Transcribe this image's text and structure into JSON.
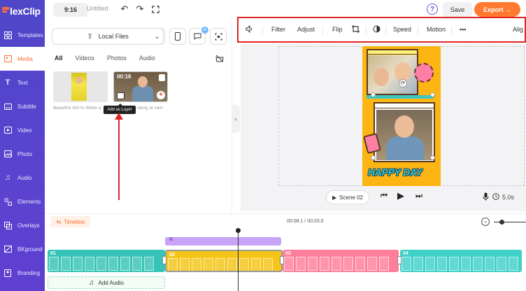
{
  "app": {
    "logo_text": "lexClip"
  },
  "sidebar": {
    "items": [
      {
        "label": "Templates",
        "icon": "templates-icon"
      },
      {
        "label": "Media",
        "icon": "media-icon",
        "active": true
      },
      {
        "label": "Text",
        "icon": "text-icon"
      },
      {
        "label": "Subtitle",
        "icon": "subtitle-icon"
      },
      {
        "label": "Video",
        "icon": "video-icon"
      },
      {
        "label": "Photo",
        "icon": "photo-icon"
      },
      {
        "label": "Audio",
        "icon": "audio-icon"
      },
      {
        "label": "Elements",
        "icon": "elements-icon"
      },
      {
        "label": "Overlays",
        "icon": "overlays-icon"
      },
      {
        "label": "BKground",
        "icon": "background-icon"
      },
      {
        "label": "Branding",
        "icon": "branding-icon"
      }
    ]
  },
  "topbar": {
    "ratio": "9:16",
    "title": "Untitled",
    "save_label": "Save",
    "export_label": "Export →",
    "help_label": "?"
  },
  "media_panel": {
    "local_files_label": "Local Files",
    "tabs": [
      "All",
      "Videos",
      "Photos",
      "Audio"
    ],
    "active_tab": "All",
    "items": [
      {
        "caption": "Beautiful Girl In White a",
        "type": "photo"
      },
      {
        "caption": "oking at cam",
        "duration": "00:16",
        "type": "video"
      }
    ],
    "tooltip": "Add as Layer",
    "ai_badge": "AI"
  },
  "toolbar": {
    "items": [
      "Filter",
      "Adjust",
      "Flip",
      "Speed",
      "Motion",
      "•••",
      "Alig"
    ]
  },
  "canvas": {
    "text_overlay": "HAPPY DAY",
    "scene_label": "Scene 02",
    "duration": "5.0s"
  },
  "timeline": {
    "label": "Timeline",
    "time": "00:08.1 / 00:20.0",
    "clips": [
      {
        "num": "01",
        "color": "#37c4b8"
      },
      {
        "num": "02",
        "color": "#f5c518"
      },
      {
        "num": "03",
        "color": "#ff7e9b"
      },
      {
        "num": "04",
        "color": "#3fd0c8"
      }
    ],
    "add_audio_label": "Add Audio"
  },
  "colors": {
    "sidebar": "#5244cc",
    "accent": "#ff7a30",
    "highlight": "#e02424"
  }
}
